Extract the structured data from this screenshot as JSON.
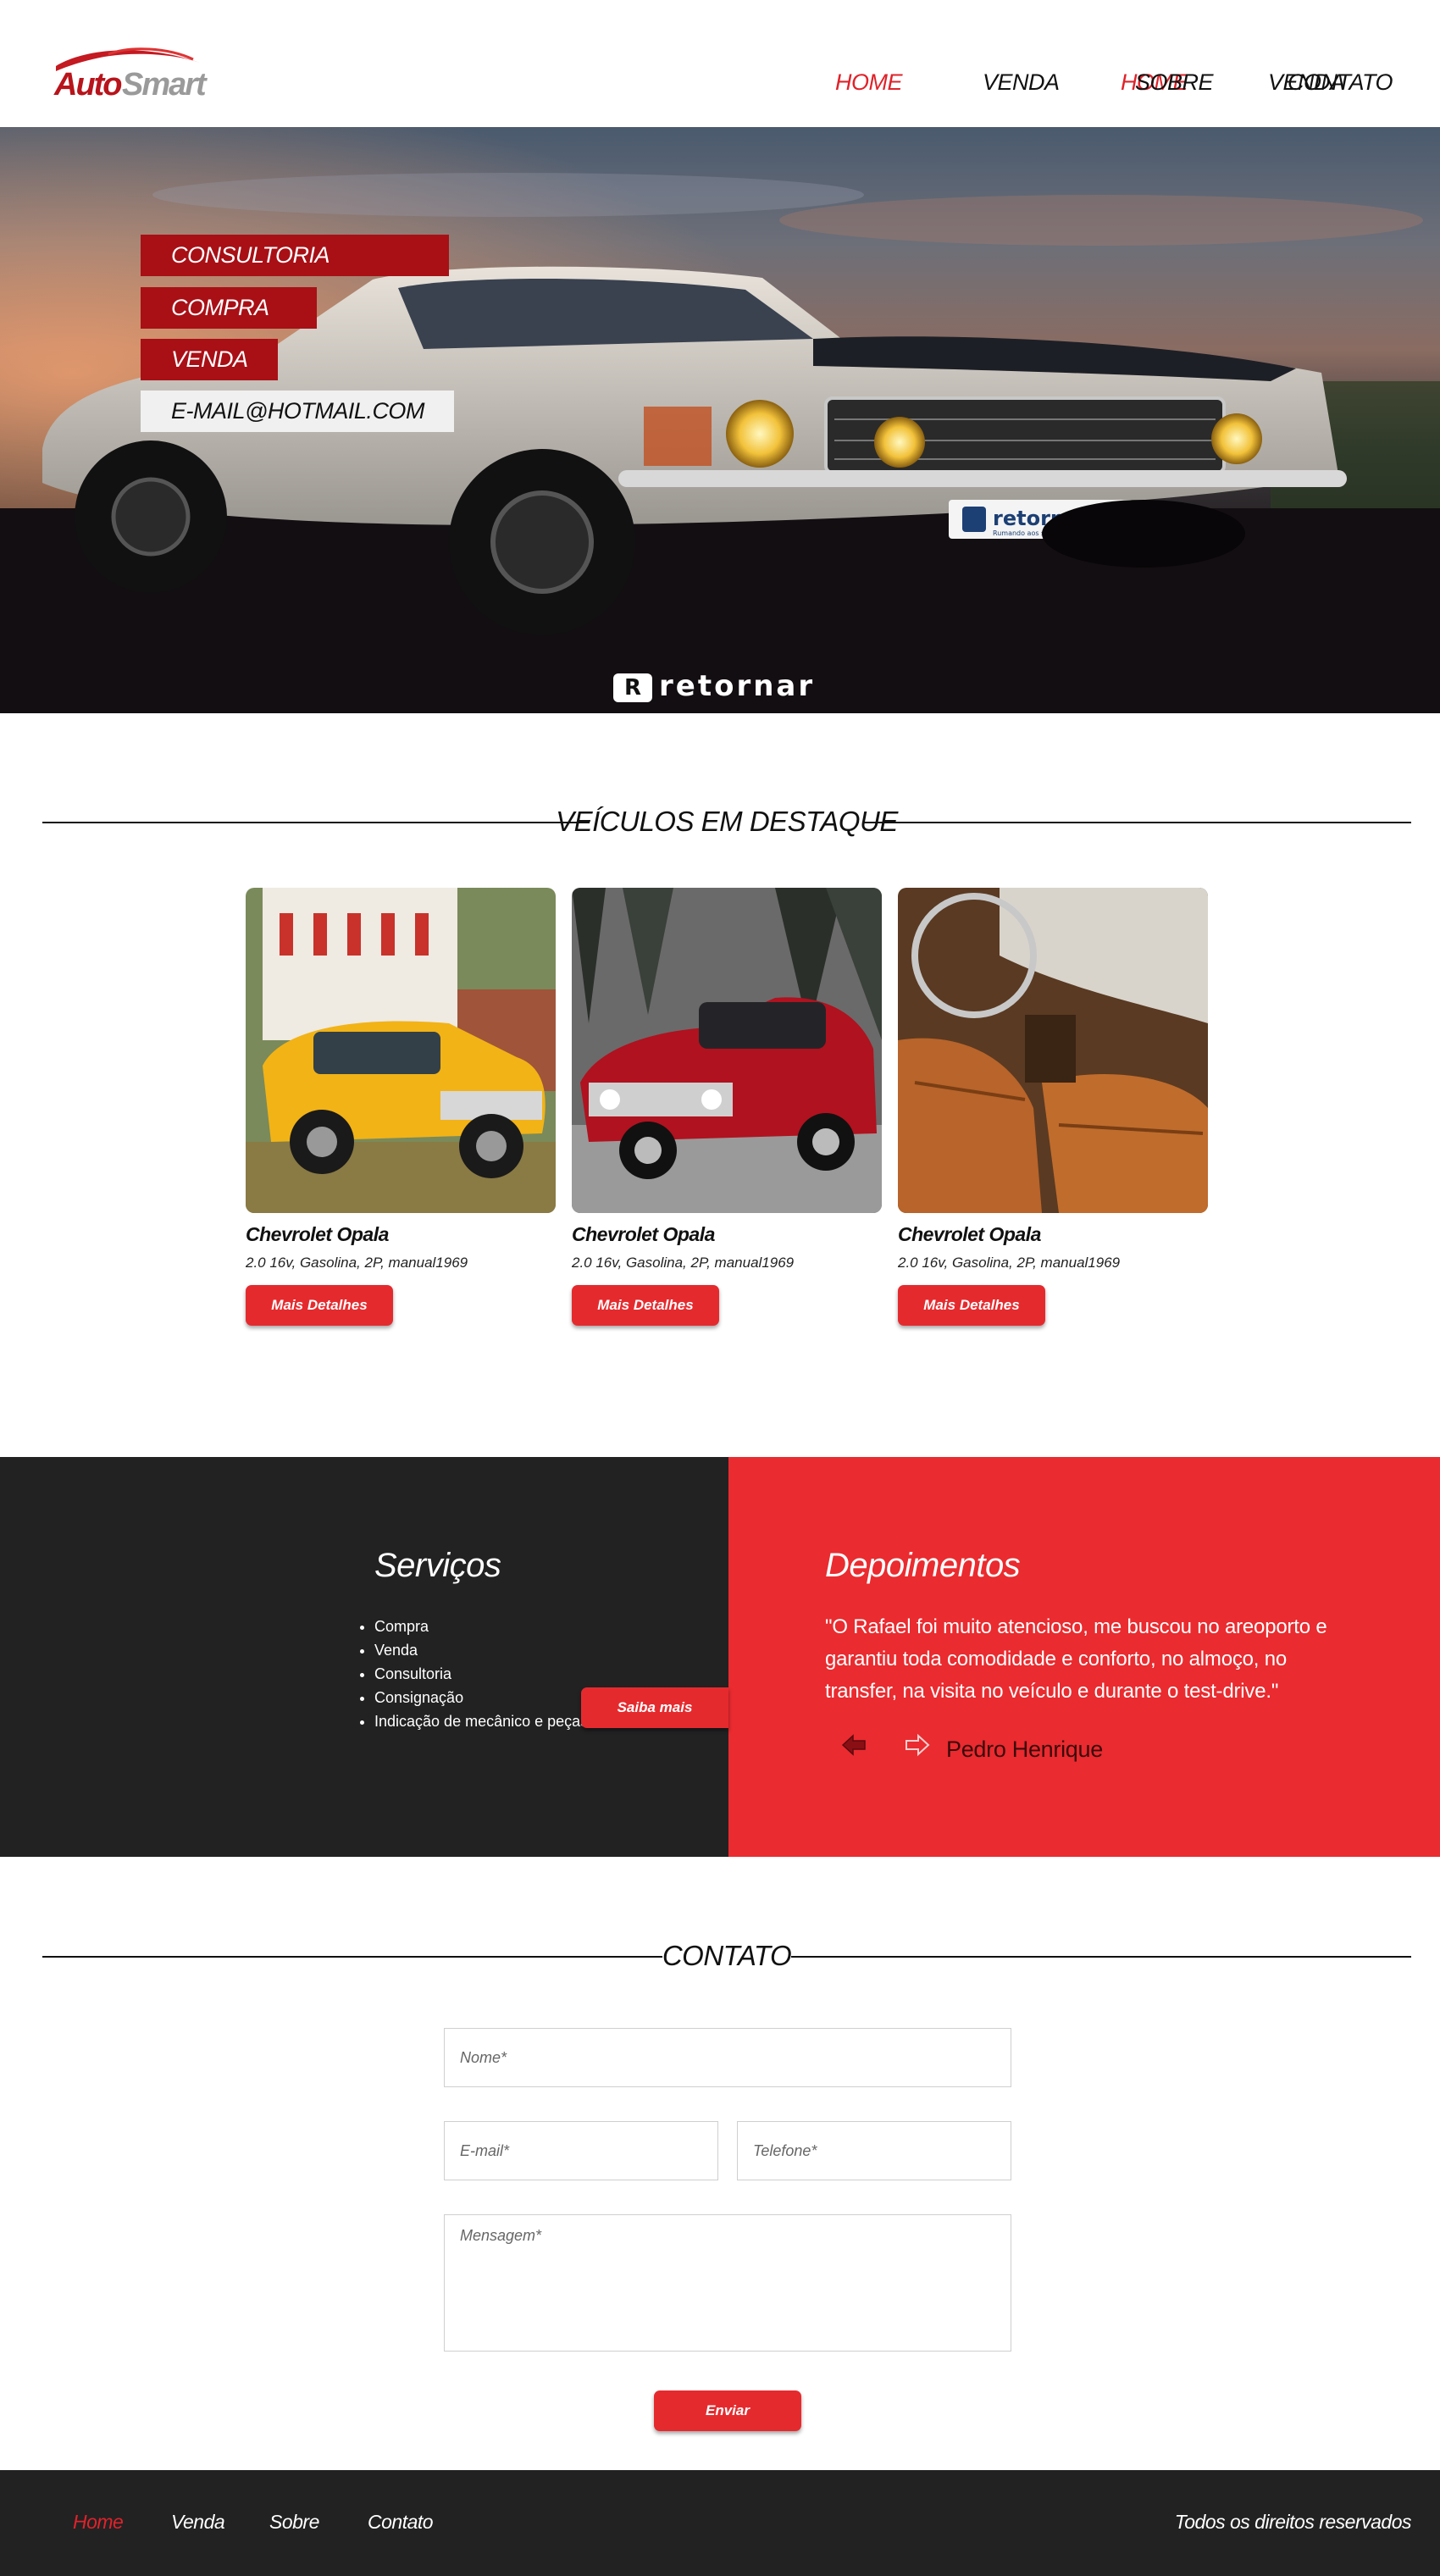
{
  "brand": {
    "logo_text_1": "Auto",
    "logo_text_2": "Smart",
    "colors": {
      "accent": "#e52a2e",
      "dark": "#222223",
      "hero_tag": "#a81016"
    }
  },
  "nav": {
    "items": [
      {
        "label": "HOME",
        "active": true
      },
      {
        "label": "VENDA",
        "active": false
      },
      {
        "label": "SOBRE",
        "active": false
      },
      {
        "label": "CONTATO",
        "active": false
      }
    ]
  },
  "hero": {
    "tags": [
      "CONSULTORIA",
      "COMPRA",
      "VENDA"
    ],
    "email": "E-MAIL@HOTMAIL.COM",
    "watermark": "retornar",
    "plate_text": "retornar",
    "plate_subtext": "Rumando aos seus sonhos"
  },
  "featured": {
    "title": "VEÍCULOS EM DESTAQUE",
    "cards": [
      {
        "name": "Chevrolet Opala",
        "specs": "2.0 16v, Gasolina, 2P, manual1969",
        "button": "Mais Detalhes",
        "image": "yellow-classic-car-photo"
      },
      {
        "name": "Chevrolet Opala",
        "specs": "2.0 16v, Gasolina, 2P, manual1969",
        "button": "Mais Detalhes",
        "image": "red-classic-car-photo"
      },
      {
        "name": "Chevrolet Opala",
        "specs": "2.0 16v, Gasolina, 2P, manual1969",
        "button": "Mais Detalhes",
        "image": "leather-interior-photo"
      }
    ]
  },
  "services": {
    "title": "Serviços",
    "items": [
      "Compra",
      "Venda",
      "Consultoria",
      "Consignação",
      "Indicação de mecânico e peças"
    ],
    "button": "Saiba mais"
  },
  "testimonials": {
    "title": "Depoimentos",
    "quote": "\"O Rafael foi muito atencioso, me buscou no areoporto e garantiu toda comodidade e conforto, no almoço, no transfer, na visita no veículo e durante o test-drive.\"",
    "author": "Pedro Henrique",
    "prev_icon": "arrow-left-icon",
    "next_icon": "arrow-right-icon"
  },
  "contact": {
    "title": "CONTATO",
    "name_placeholder": "Nome*",
    "email_placeholder": "E-mail*",
    "phone_placeholder": "Telefone*",
    "message_placeholder": "Mensagem*",
    "submit": "Enviar"
  },
  "footer": {
    "links": [
      {
        "label": "Home",
        "active": true
      },
      {
        "label": "Venda",
        "active": false
      },
      {
        "label": "Sobre",
        "active": false
      },
      {
        "label": "Contato",
        "active": false
      }
    ],
    "rights": "Todos os direitos reservados"
  }
}
